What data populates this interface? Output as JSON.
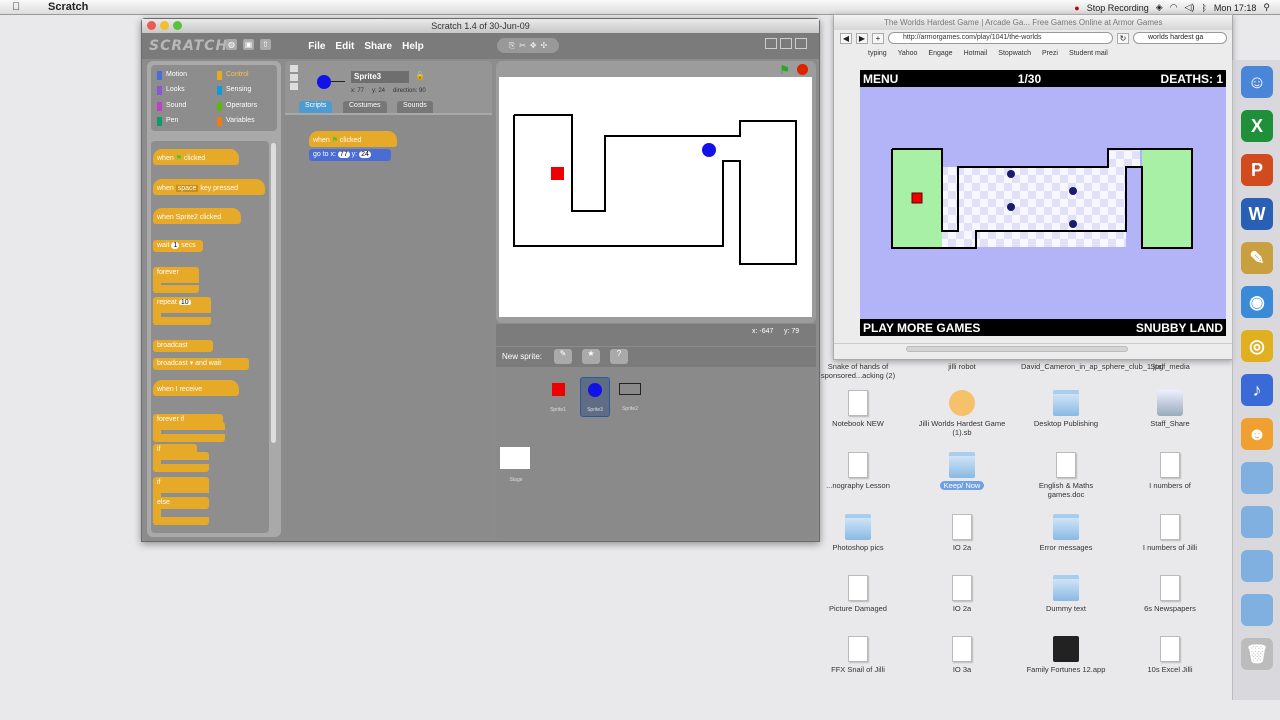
{
  "menubar": {
    "app_name": "Scratch",
    "recording": "Stop Recording",
    "clock": "Mon 17:18"
  },
  "scratch": {
    "window_title": "Scratch 1.4 of 30-Jun-09",
    "logo": "SCRATCH",
    "menu": [
      "File",
      "Edit",
      "Share",
      "Help"
    ],
    "categories": [
      {
        "label": "Motion",
        "color": "#4a6cd4"
      },
      {
        "label": "Control",
        "color": "#e6a928"
      },
      {
        "label": "Looks",
        "color": "#8a55d7"
      },
      {
        "label": "Sensing",
        "color": "#0e9bd8"
      },
      {
        "label": "Sound",
        "color": "#bb42c3"
      },
      {
        "label": "Operators",
        "color": "#5cb712"
      },
      {
        "label": "Pen",
        "color": "#0e9a6c"
      },
      {
        "label": "Variables",
        "color": "#ee7d16"
      }
    ],
    "blocks": {
      "when_flag": "when",
      "when_flag_suffix": "clicked",
      "when_key": "when",
      "key_value": "space",
      "key_suffix": "key pressed",
      "when_sprite": "when Sprite2 clicked",
      "wait": "wait",
      "wait_value": "1",
      "wait_suffix": "secs",
      "forever": "forever",
      "repeat": "repeat",
      "repeat_value": "10",
      "broadcast": "broadcast",
      "broadcast_wait": "broadcast",
      "broadcast_wait_suffix": "and wait",
      "when_receive": "when I receive",
      "forever_if": "forever if",
      "if": "if",
      "if_else": "if",
      "else": "else"
    },
    "sprite": {
      "name": "Sprite3",
      "x": "x: 77",
      "y": "y: 24",
      "direction": "direction: 90"
    },
    "tabs": [
      "Scripts",
      "Costumes",
      "Sounds"
    ],
    "script": {
      "hat": "when",
      "hat_suffix": "clicked",
      "goto": "go to x:",
      "goto_x": "77",
      "goto_y_label": "y:",
      "goto_y": "24"
    },
    "mouse": {
      "x": "x: -647",
      "y": "y: 79"
    },
    "new_sprite_label": "New sprite:",
    "sprite_list": [
      "Sprite1",
      "Sprite3",
      "Sprite2"
    ],
    "stage_label": "Stage"
  },
  "browser": {
    "title": "The Worlds Hardest Game | Arcade Ga... Free Games Online at Armor Games",
    "url": "http://armorgames.com/play/1041/the-worlds",
    "search": "worlds hardest ga",
    "bookmarks": [
      "typing",
      "Yahoo",
      "Engage",
      "Hotmail",
      "Stopwatch",
      "Prezi",
      "Student mail"
    ],
    "game": {
      "menu": "MENU",
      "level": "1/30",
      "deaths": "DEATHS: 1",
      "play_more": "PLAY MORE GAMES",
      "brand": "SNUBBY LAND"
    }
  },
  "desktop": {
    "icons": [
      {
        "label": "Snake of hands of sponsored...acking (2)",
        "type": "doc"
      },
      {
        "label": "jilli robot",
        "type": "doc"
      },
      {
        "label": "David_Cameron_in_ap_sphere_club_1.jpg",
        "type": "doc"
      },
      {
        "label": "Stalf_media",
        "type": "doc"
      },
      {
        "label": "Notebook NEW",
        "type": "doc"
      },
      {
        "label": "Jilli Worlds Hardest Game (1).sb",
        "type": "scratch"
      },
      {
        "label": "Desktop Publishing",
        "type": "folder"
      },
      {
        "label": "Staff_Share",
        "type": "drive"
      },
      {
        "label": "...nography Lesson",
        "type": "doc"
      },
      {
        "label": "Keep/ Now",
        "type": "folder"
      },
      {
        "label": "English & Maths games.doc",
        "type": "doc"
      },
      {
        "label": "I numbers of",
        "type": "doc"
      },
      {
        "label": "Photoshop pics",
        "type": "folder"
      },
      {
        "label": "IO 2a",
        "type": "doc"
      },
      {
        "label": "Error messages",
        "type": "folder"
      },
      {
        "label": "I numbers of Jilli",
        "type": "doc"
      },
      {
        "label": "Picture Damaged",
        "type": "doc"
      },
      {
        "label": "IO 2a",
        "type": "doc"
      },
      {
        "label": "Dummy text",
        "type": "folder"
      },
      {
        "label": "6s Newspapers",
        "type": "doc"
      },
      {
        "label": "FFX Snail of Jilli",
        "type": "doc"
      },
      {
        "label": "IO 3a",
        "type": "doc"
      },
      {
        "label": "Family Fortunes 12.app",
        "type": "app"
      },
      {
        "label": "10s Excel Jilli",
        "type": "doc"
      }
    ]
  },
  "dock": {
    "apps": [
      {
        "name": "finder",
        "color": "#4a86d8",
        "glyph": "☺"
      },
      {
        "name": "excel",
        "color": "#1f8f3a",
        "glyph": "X"
      },
      {
        "name": "powerpoint",
        "color": "#d24b1f",
        "glyph": "P"
      },
      {
        "name": "word",
        "color": "#2a5fb6",
        "glyph": "W"
      },
      {
        "name": "preview",
        "color": "#c8a040",
        "glyph": "✎"
      },
      {
        "name": "safari",
        "color": "#3a8ad8",
        "glyph": "◉"
      },
      {
        "name": "chrome",
        "color": "#e0b020",
        "glyph": "◎"
      },
      {
        "name": "itunes",
        "color": "#3a6ad8",
        "glyph": "♪"
      },
      {
        "name": "scratch",
        "color": "#f0a030",
        "glyph": "☻"
      },
      {
        "name": "folder-1",
        "color": "#7fb0e0",
        "glyph": ""
      },
      {
        "name": "folder-2",
        "color": "#7fb0e0",
        "glyph": ""
      },
      {
        "name": "folder-3",
        "color": "#7fb0e0",
        "glyph": ""
      },
      {
        "name": "folder-4",
        "color": "#7fb0e0",
        "glyph": ""
      },
      {
        "name": "trash",
        "color": "#bcbcbc",
        "glyph": "🗑"
      }
    ]
  }
}
